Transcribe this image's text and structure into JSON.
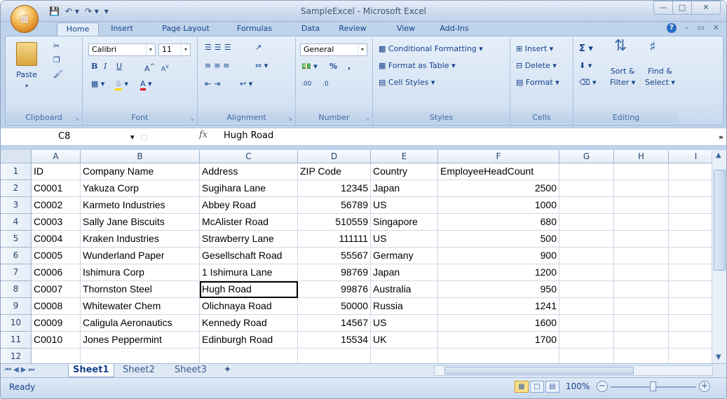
{
  "app": {
    "title": "SampleExcel - Microsoft Excel",
    "office_button_label": "Office"
  },
  "ribbon_tabs": [
    "Home",
    "Insert",
    "Page Layout",
    "Formulas",
    "Data",
    "Review",
    "View",
    "Add-Ins"
  ],
  "clipboard": {
    "paste": "Paste",
    "label": "Clipboard"
  },
  "font": {
    "name": "Calibri",
    "size": "11",
    "label": "Font",
    "bold": "B",
    "italic": "I",
    "underline": "U"
  },
  "alignment": {
    "label": "Alignment"
  },
  "number": {
    "format": "General",
    "label": "Number",
    "percent": "%",
    "comma": ",",
    "inc": ".00",
    "dec": ".0"
  },
  "styles": {
    "conditional": "Conditional Formatting",
    "format_table": "Format as Table",
    "cell_styles": "Cell Styles",
    "label": "Styles"
  },
  "cells": {
    "insert": "Insert",
    "delete": "Delete",
    "format": "Format",
    "label": "Cells"
  },
  "editing": {
    "sum": "Σ",
    "sort": "Sort &",
    "filter": "Filter",
    "find": "Find &",
    "select": "Select",
    "label": "Editing"
  },
  "formula_bar": {
    "name_box": "C8",
    "fx": "fx",
    "value": "Hugh Road"
  },
  "columns": [
    "A",
    "B",
    "C",
    "D",
    "E",
    "F",
    "G",
    "H",
    "I"
  ],
  "rows": [
    [
      "ID",
      "Company Name",
      "Address",
      "ZIP Code",
      "Country",
      "EmployeeHeadCount"
    ],
    [
      "C0001",
      "Yakuza Corp",
      "Sugihara Lane",
      "12345",
      "Japan",
      "2500"
    ],
    [
      "C0002",
      "Karmeto Industries",
      "Abbey Road",
      "56789",
      "US",
      "1000"
    ],
    [
      "C0003",
      "Sally Jane Biscuits",
      "McAlister Road",
      "510559",
      "Singapore",
      "680"
    ],
    [
      "C0004",
      "Kraken Industries",
      "Strawberry Lane",
      "111111",
      "US",
      "500"
    ],
    [
      "C0005",
      "Wunderland Paper",
      "Gesellschaft Road",
      "55567",
      "Germany",
      "900"
    ],
    [
      "C0006",
      "Ishimura Corp",
      "1 Ishimura Lane",
      "98769",
      "Japan",
      "1200"
    ],
    [
      "C0007",
      "Thornston Steel",
      "Hugh Road",
      "99876",
      "Australia",
      "950"
    ],
    [
      "C0008",
      "Whitewater Chem",
      "Olichnaya Road",
      "50000",
      "Russia",
      "1241"
    ],
    [
      "C0009",
      "Caligula Aeronautics",
      "Kennedy Road",
      "14567",
      "US",
      "1600"
    ],
    [
      "C0010",
      "Jones Peppermint",
      "Edinburgh Road",
      "15534",
      "UK",
      "1700"
    ],
    [
      "",
      "",
      "",
      "",
      "",
      ""
    ]
  ],
  "row_numbers": [
    "1",
    "2",
    "3",
    "4",
    "5",
    "6",
    "7",
    "8",
    "9",
    "10",
    "11",
    "12"
  ],
  "sheets": [
    "Sheet1",
    "Sheet2",
    "Sheet3"
  ],
  "status": {
    "text": "Ready",
    "zoom": "100%"
  }
}
